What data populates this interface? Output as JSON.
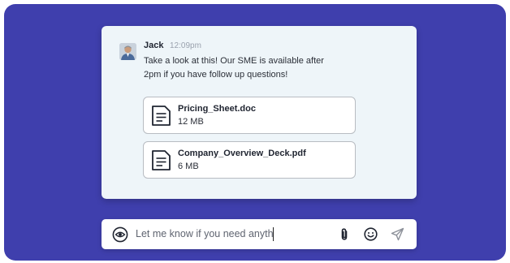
{
  "message": {
    "sender": "Jack",
    "time": "12:09pm",
    "text": "Take a look at this! Our SME is available after 2pm if you have follow up questions!"
  },
  "attachments": [
    {
      "name": "Pricing_Sheet.doc",
      "size": "12 MB"
    },
    {
      "name": "Company_Overview_Deck.pdf",
      "size": "6 MB"
    }
  ],
  "composer": {
    "value": "Let me know if you need anyth"
  },
  "colors": {
    "background": "#3f3fad",
    "card": "#eef5f9"
  },
  "icons": {
    "visibility": "eye-icon",
    "attach": "paperclip-icon",
    "emoji": "smiley-icon",
    "send": "send-icon"
  }
}
